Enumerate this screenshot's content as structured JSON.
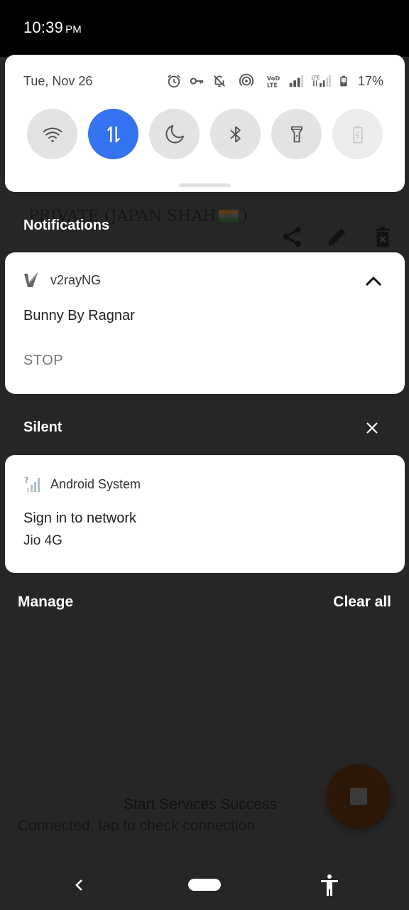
{
  "status_bar": {
    "time": "10:39",
    "ampm": "PM"
  },
  "quick_settings": {
    "date": "Tue, Nov 26",
    "battery_percent": "17%",
    "status_icons": [
      "alarm-icon",
      "vpn-key-icon",
      "notifications-off-icon",
      "hotspot-icon",
      "volte-icon",
      "signal-icon",
      "lte-signal-icon",
      "battery-charging-icon"
    ],
    "tiles": [
      {
        "name": "wifi",
        "icon": "wifi-icon",
        "active": false
      },
      {
        "name": "mobile-data",
        "icon": "data-arrows-icon",
        "active": true
      },
      {
        "name": "dark-theme",
        "icon": "moon-icon",
        "active": false
      },
      {
        "name": "bluetooth",
        "icon": "bluetooth-icon",
        "active": false
      },
      {
        "name": "flashlight",
        "icon": "flashlight-icon",
        "active": false
      },
      {
        "name": "battery-saver",
        "icon": "battery-saver-icon",
        "active": false,
        "disabled": true
      }
    ],
    "accent_color": "#3574f0"
  },
  "notifications": {
    "header": "Notifications",
    "items": [
      {
        "app": "v2rayNG",
        "title": "Bunny By Ragnar",
        "action": "STOP",
        "expanded": true
      }
    ]
  },
  "silent": {
    "header": "Silent",
    "items": [
      {
        "app": "Android System",
        "title": "Sign in to network",
        "text": "Jio 4G"
      }
    ]
  },
  "footer": {
    "manage": "Manage",
    "clear_all": "Clear all"
  },
  "background_app": {
    "title": "PRIVATE (",
    "title_name": "JAPAN SHAH",
    "title_end": ")",
    "toast": "Start Services Success",
    "status": "Connected, tap to check connection"
  }
}
